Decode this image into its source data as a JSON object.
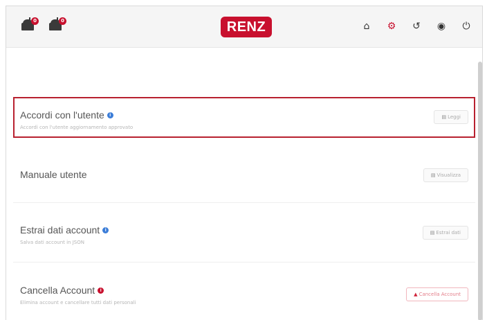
{
  "header": {
    "logo_text": "RENZ",
    "mailbox_badges": [
      "0",
      "0"
    ],
    "nav_icons": [
      "home-icon",
      "gear-icon",
      "history-icon",
      "globe-icon",
      "power-icon"
    ]
  },
  "rows": [
    {
      "title": "Accordi con l'utente",
      "subtitle": "Accordi con l'utente aggiornamento approvato",
      "button": "Leggi"
    },
    {
      "title": "Manuale utente",
      "subtitle": "",
      "button": "Visualizza"
    },
    {
      "title": "Estrai dati account",
      "subtitle": "Salva dati account in JSON",
      "button": "Estrai dati"
    },
    {
      "title": "Cancella Account",
      "subtitle": "Elimina account e cancellare tutti dati personali",
      "button": "Cancella Account"
    }
  ],
  "colors": {
    "brand": "#c8102e",
    "info": "#3b7dd8"
  }
}
